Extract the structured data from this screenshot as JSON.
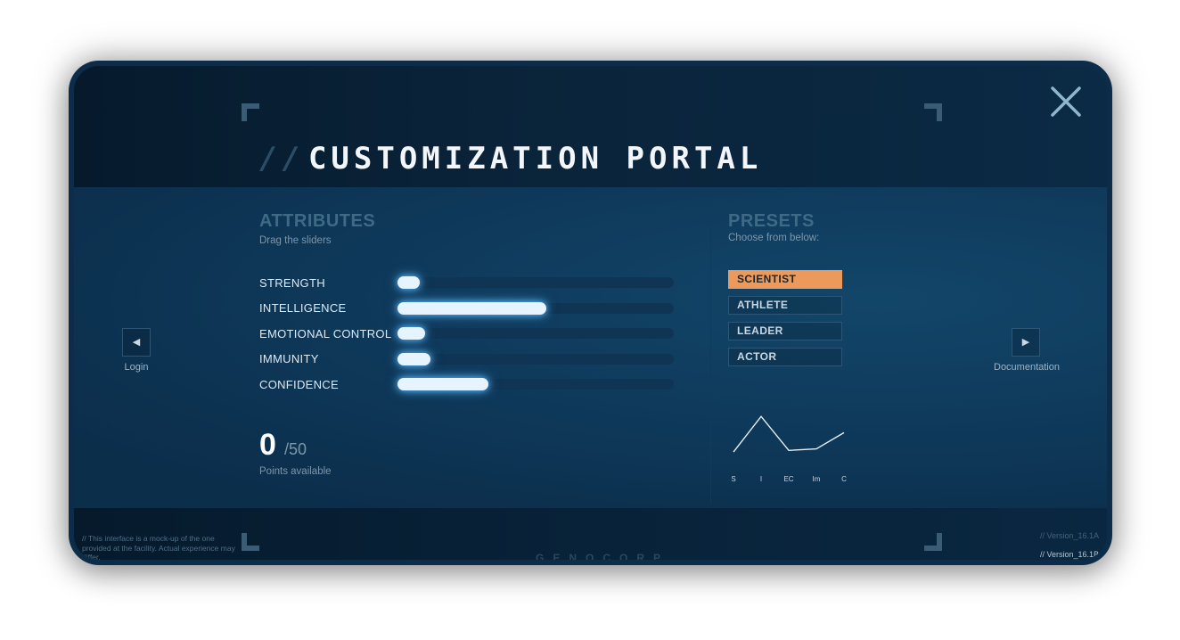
{
  "title": {
    "slashes": "//",
    "text": "CUSTOMIZATION PORTAL"
  },
  "attributes": {
    "heading": "ATTRIBUTES",
    "subheading": "Drag the sliders",
    "items": [
      {
        "label": "STRENGTH",
        "value": 0.08
      },
      {
        "label": "INTELLIGENCE",
        "value": 0.54
      },
      {
        "label": "EMOTIONAL CONTROL",
        "value": 0.1
      },
      {
        "label": "IMMUNITY",
        "value": 0.12
      },
      {
        "label": "CONFIDENCE",
        "value": 0.33
      }
    ]
  },
  "points": {
    "value": "0",
    "max": "/50",
    "caption": "Points available"
  },
  "presets": {
    "heading": "PRESETS",
    "subheading": "Choose from below:",
    "items": [
      {
        "label": "SCIENTIST",
        "active": true
      },
      {
        "label": "ATHLETE",
        "active": false
      },
      {
        "label": "LEADER",
        "active": false
      },
      {
        "label": "ACTOR",
        "active": false
      }
    ]
  },
  "chart_data": {
    "type": "line",
    "categories": [
      "S",
      "I",
      "EC",
      "Im",
      "C"
    ],
    "values": [
      0.08,
      0.54,
      0.1,
      0.12,
      0.33
    ],
    "ylim": [
      0,
      0.6
    ],
    "grid": false
  },
  "nav": {
    "left": {
      "label": "Login",
      "icon": "arrow-left-icon"
    },
    "right": {
      "label": "Documentation",
      "icon": "arrow-right-icon"
    }
  },
  "footer": {
    "disclaimer": "// This interface is a mock-up of the one provided at the facility. Actual experience may differ.",
    "brand": "GENOCORP",
    "version_a": "// Version_16.1A",
    "version_b": "// Version_16.1B"
  },
  "colors": {
    "accent": "#eb9a5c",
    "slider_fill": "#e6f4ff",
    "slider_glow": "#5ab8ff",
    "background": "#0e3555"
  }
}
